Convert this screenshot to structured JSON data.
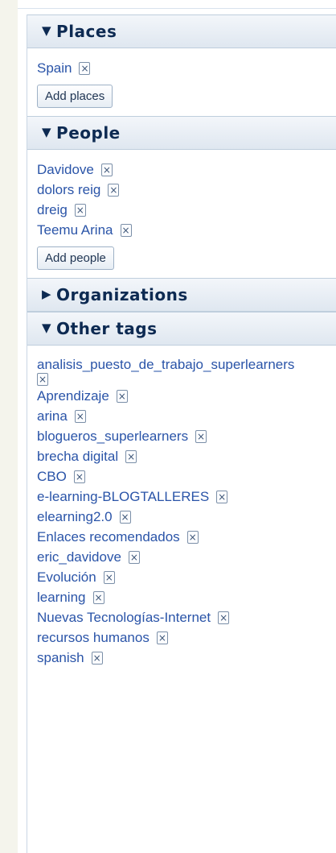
{
  "places": {
    "title": "Places",
    "tags": [
      "Spain"
    ],
    "add_label": "Add places"
  },
  "people": {
    "title": "People",
    "tags": [
      "Davidove",
      "dolors reig",
      "dreig",
      "Teemu Arina"
    ],
    "add_label": "Add people"
  },
  "organizations": {
    "title": "Organizations"
  },
  "other_tags": {
    "title": "Other tags",
    "tags": [
      "analisis_puesto_de_trabajo_superlearners",
      "Aprendizaje",
      "arina",
      "blogueros_superlearners",
      "brecha digital",
      "CBO",
      "e-learning-BLOGTALLERES",
      "elearning2.0",
      "Enlaces recomendados",
      "eric_davidove",
      "Evolución",
      "learning",
      "Nuevas Tecnologías-Internet",
      "recursos humanos",
      "spanish"
    ]
  },
  "icons": {
    "expanded": "triangle-down-icon",
    "collapsed": "triangle-right-icon",
    "remove": "close-box-icon"
  }
}
